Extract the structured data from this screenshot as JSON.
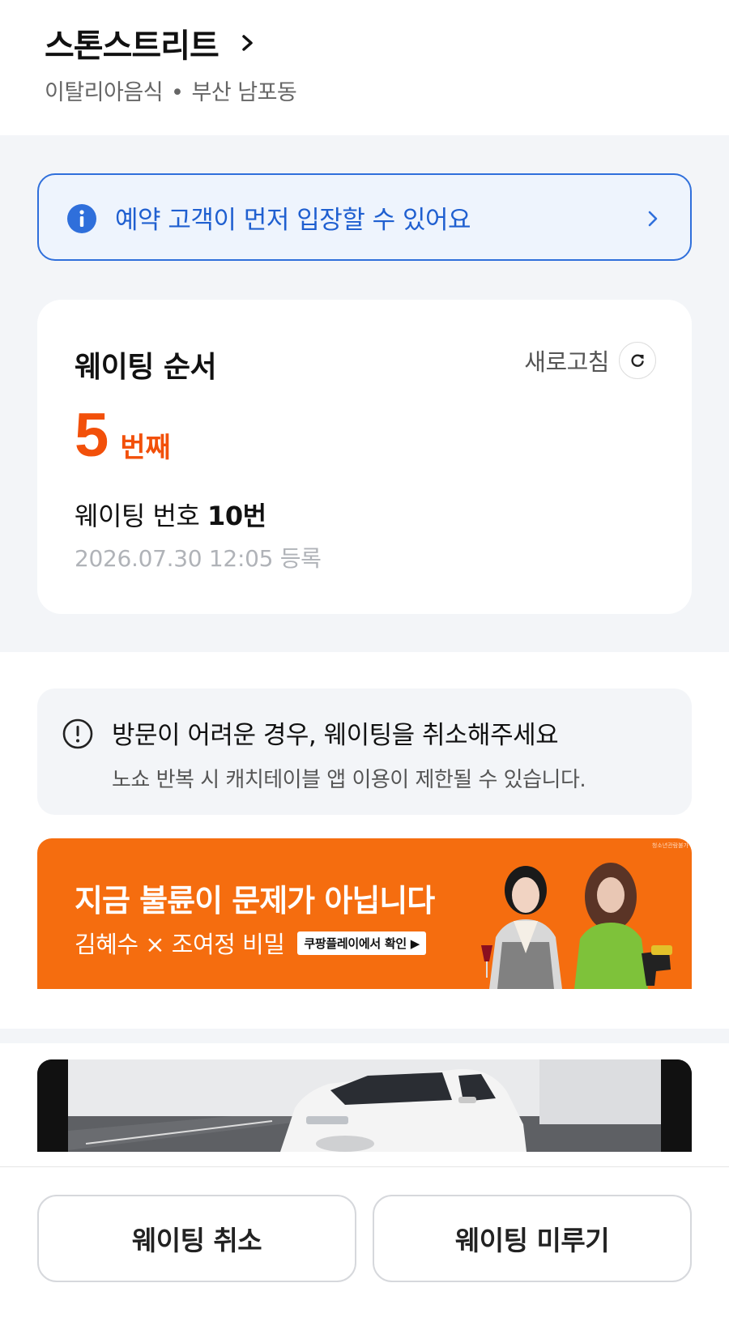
{
  "header": {
    "store_name": "스톤스트리트",
    "category": "이탈리아음식",
    "separator": "•",
    "location": "부산 남포동"
  },
  "notice": {
    "text": "예약 고객이 먼저 입장할 수 있어요"
  },
  "waiting": {
    "title": "웨이팅 순서",
    "refresh_label": "새로고침",
    "queue_position": "5",
    "queue_unit": "번째",
    "number_label": "웨이팅 번호",
    "number_value": "10번",
    "registered": "2026.07.30 12:05 등록"
  },
  "warning": {
    "title": "방문이 어려운 경우, 웨이팅을 취소해주세요",
    "description": "노쇼 반복 시 캐치테이블 앱 이용이 제한될 수 있습니다."
  },
  "ad": {
    "headline": "지금 불륜이 문제가 아닙니다",
    "subline": "김혜수 × 조여정 비밀",
    "cta": "쿠팡플레이에서 확인 ▶",
    "small_print": "청소년관람불가"
  },
  "actions": {
    "cancel_label": "웨이팅 취소",
    "postpone_label": "웨이팅 미루기"
  },
  "colors": {
    "accent_orange": "#f2500a",
    "info_blue": "#2f6fdb",
    "ad_orange": "#f56d0f",
    "section_gray": "#f3f5f8"
  }
}
